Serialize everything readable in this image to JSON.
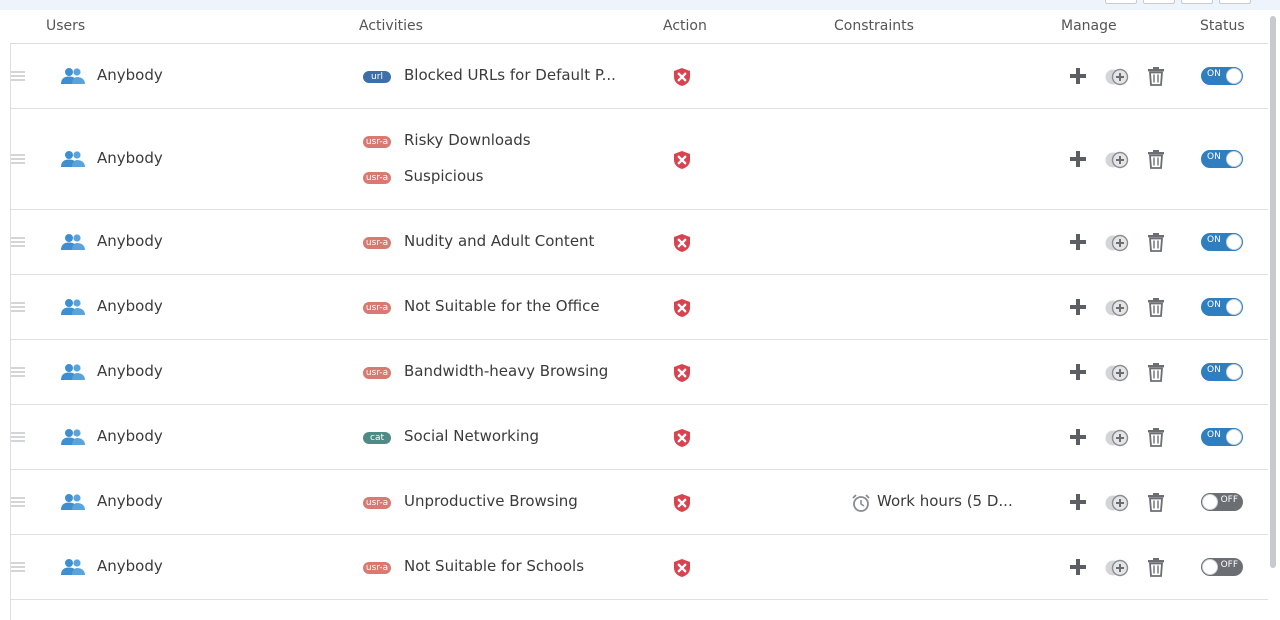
{
  "columns": {
    "users": "Users",
    "activities": "Activities",
    "action": "Action",
    "constraints": "Constraints",
    "manage": "Manage",
    "status": "Status"
  },
  "colors": {
    "accent": "#2f7fc0",
    "block_red": "#d9434f",
    "badge_url": "#3e6fa8",
    "badge_usra": "#d97a72",
    "badge_cat": "#4f8a86"
  },
  "icons": {
    "user": "users-icon",
    "action": "block-shield-icon",
    "add": "plus-icon",
    "clone": "clone-icon",
    "delete": "trash-icon",
    "constraint": "alarm-clock-icon"
  },
  "rows": [
    {
      "user": "Anybody",
      "activities": [
        {
          "badge": "url",
          "label": "Blocked URLs for Default P..."
        }
      ],
      "constraint": "",
      "status": "ON"
    },
    {
      "user": "Anybody",
      "activities": [
        {
          "badge": "usr-a",
          "label": "Risky Downloads"
        },
        {
          "badge": "usr-a",
          "label": "Suspicious"
        }
      ],
      "constraint": "",
      "status": "ON"
    },
    {
      "user": "Anybody",
      "activities": [
        {
          "badge": "usr-a",
          "label": "Nudity and Adult Content"
        }
      ],
      "constraint": "",
      "status": "ON"
    },
    {
      "user": "Anybody",
      "activities": [
        {
          "badge": "usr-a",
          "label": "Not Suitable for the Office"
        }
      ],
      "constraint": "",
      "status": "ON"
    },
    {
      "user": "Anybody",
      "activities": [
        {
          "badge": "usr-a",
          "label": "Bandwidth-heavy Browsing"
        }
      ],
      "constraint": "",
      "status": "ON"
    },
    {
      "user": "Anybody",
      "activities": [
        {
          "badge": "cat",
          "label": "Social Networking"
        }
      ],
      "constraint": "",
      "status": "ON"
    },
    {
      "user": "Anybody",
      "activities": [
        {
          "badge": "usr-a",
          "label": "Unproductive Browsing"
        }
      ],
      "constraint": "Work hours (5 D...",
      "status": "OFF"
    },
    {
      "user": "Anybody",
      "activities": [
        {
          "badge": "usr-a",
          "label": "Not Suitable for Schools"
        }
      ],
      "constraint": "",
      "status": "OFF"
    }
  ]
}
